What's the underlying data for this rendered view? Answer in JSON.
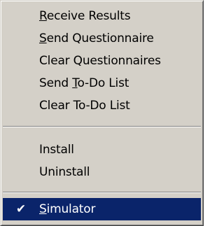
{
  "menu": {
    "items": [
      {
        "pre": "",
        "ul": "R",
        "post": "eceive Results",
        "checked": false,
        "selected": false
      },
      {
        "pre": "",
        "ul": "S",
        "post": "end Questionnaire",
        "checked": false,
        "selected": false
      },
      {
        "pre": "Clear Questionnaires",
        "ul": "",
        "post": "",
        "checked": false,
        "selected": false
      },
      {
        "pre": "Send ",
        "ul": "T",
        "post": "o-Do List",
        "checked": false,
        "selected": false
      },
      {
        "pre": "Clear To-Do List",
        "ul": "",
        "post": "",
        "checked": false,
        "selected": false
      },
      {
        "pre": "Install",
        "ul": "",
        "post": "",
        "checked": false,
        "selected": false
      },
      {
        "pre": "Uninstall",
        "ul": "",
        "post": "",
        "checked": false,
        "selected": false
      },
      {
        "pre": "",
        "ul": "S",
        "post": "imulator",
        "checked": true,
        "selected": true
      }
    ],
    "check_glyph": "✔",
    "highlight_color": "#0a246a"
  }
}
